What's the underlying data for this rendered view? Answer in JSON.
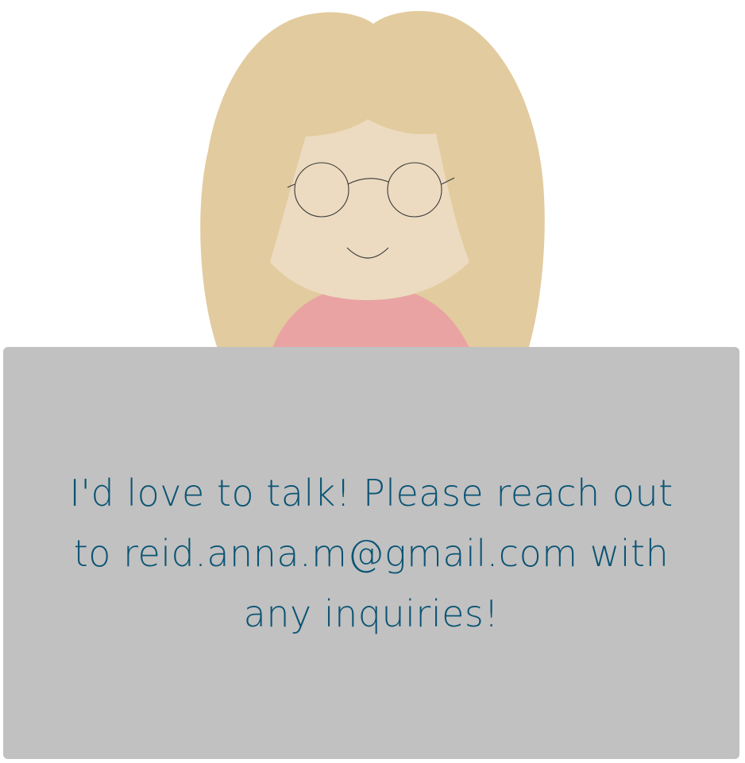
{
  "colors": {
    "hair": "#e2cb9e",
    "face": "#ecdbc0",
    "shirt": "#e9a3a3",
    "glasses": "#3a3a3a",
    "card_background": "#c1c1c1",
    "text": "#0a5474",
    "page_background": "#ffffff"
  },
  "illustration": {
    "icon": "girl-with-glasses-avatar"
  },
  "contact": {
    "message": "I'd love to talk! Please reach out to reid.anna.m@gmail.com with any inquiries!"
  }
}
